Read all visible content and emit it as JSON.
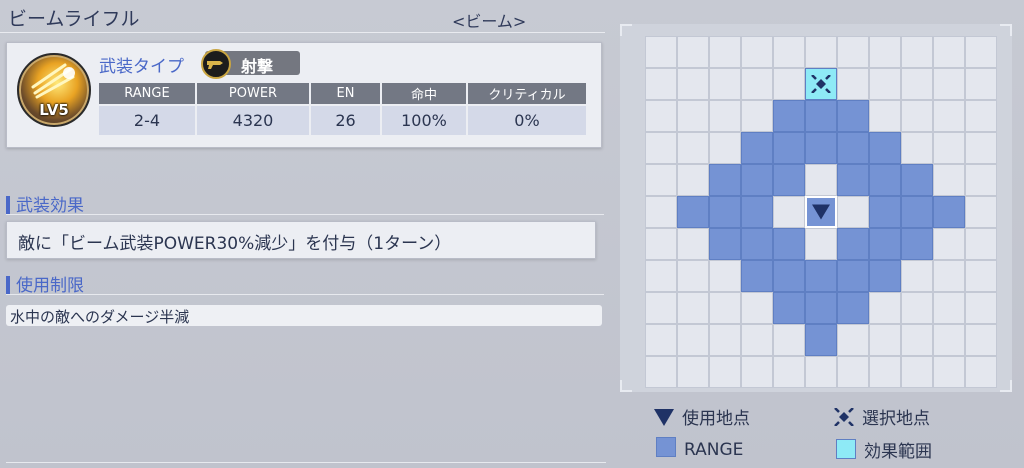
{
  "weapon": {
    "name": "ビームライフル",
    "category": "<ビーム>",
    "level": "LV5"
  },
  "type": {
    "label": "武装タイプ",
    "value": "射撃"
  },
  "stats": {
    "headers": [
      "RANGE",
      "POWER",
      "EN",
      "命中",
      "クリティカル"
    ],
    "values": [
      "2-4",
      "4320",
      "26",
      "100%",
      "0%"
    ]
  },
  "effect": {
    "heading": "武装効果",
    "text": "敵に「ビーム武装POWER30%減少」を付与（1ターン）"
  },
  "restriction": {
    "heading": "使用制限",
    "text": "水中の敵へのダメージ半減"
  },
  "grid": {
    "size": 11,
    "use_point": [
      5,
      5
    ],
    "select_point": [
      5,
      1
    ],
    "range_cells": [
      [
        5,
        1
      ],
      [
        4,
        2
      ],
      [
        5,
        2
      ],
      [
        6,
        2
      ],
      [
        3,
        3
      ],
      [
        4,
        3
      ],
      [
        5,
        3
      ],
      [
        6,
        3
      ],
      [
        7,
        3
      ],
      [
        2,
        4
      ],
      [
        3,
        4
      ],
      [
        4,
        4
      ],
      [
        6,
        4
      ],
      [
        7,
        4
      ],
      [
        8,
        4
      ],
      [
        1,
        5
      ],
      [
        2,
        5
      ],
      [
        3,
        5
      ],
      [
        7,
        5
      ],
      [
        8,
        5
      ],
      [
        9,
        5
      ],
      [
        2,
        6
      ],
      [
        3,
        6
      ],
      [
        4,
        6
      ],
      [
        6,
        6
      ],
      [
        7,
        6
      ],
      [
        8,
        6
      ],
      [
        3,
        7
      ],
      [
        4,
        7
      ],
      [
        5,
        7
      ],
      [
        6,
        7
      ],
      [
        7,
        7
      ],
      [
        4,
        8
      ],
      [
        5,
        8
      ],
      [
        6,
        8
      ],
      [
        5,
        9
      ]
    ]
  },
  "legend": {
    "use_point": "使用地点",
    "select_point": "選択地点",
    "range": "RANGE",
    "effect_area": "効果範囲"
  },
  "colors": {
    "range": "#7593d4",
    "effect_area": "#8eeaf6",
    "accent": "#4a68c8",
    "marker": "#1f3266"
  },
  "icons": {
    "use_point": "triangle-down-icon",
    "select_point": "crosshair-icon",
    "weapon": "beam-burst-icon",
    "type": "shooting-icon"
  }
}
